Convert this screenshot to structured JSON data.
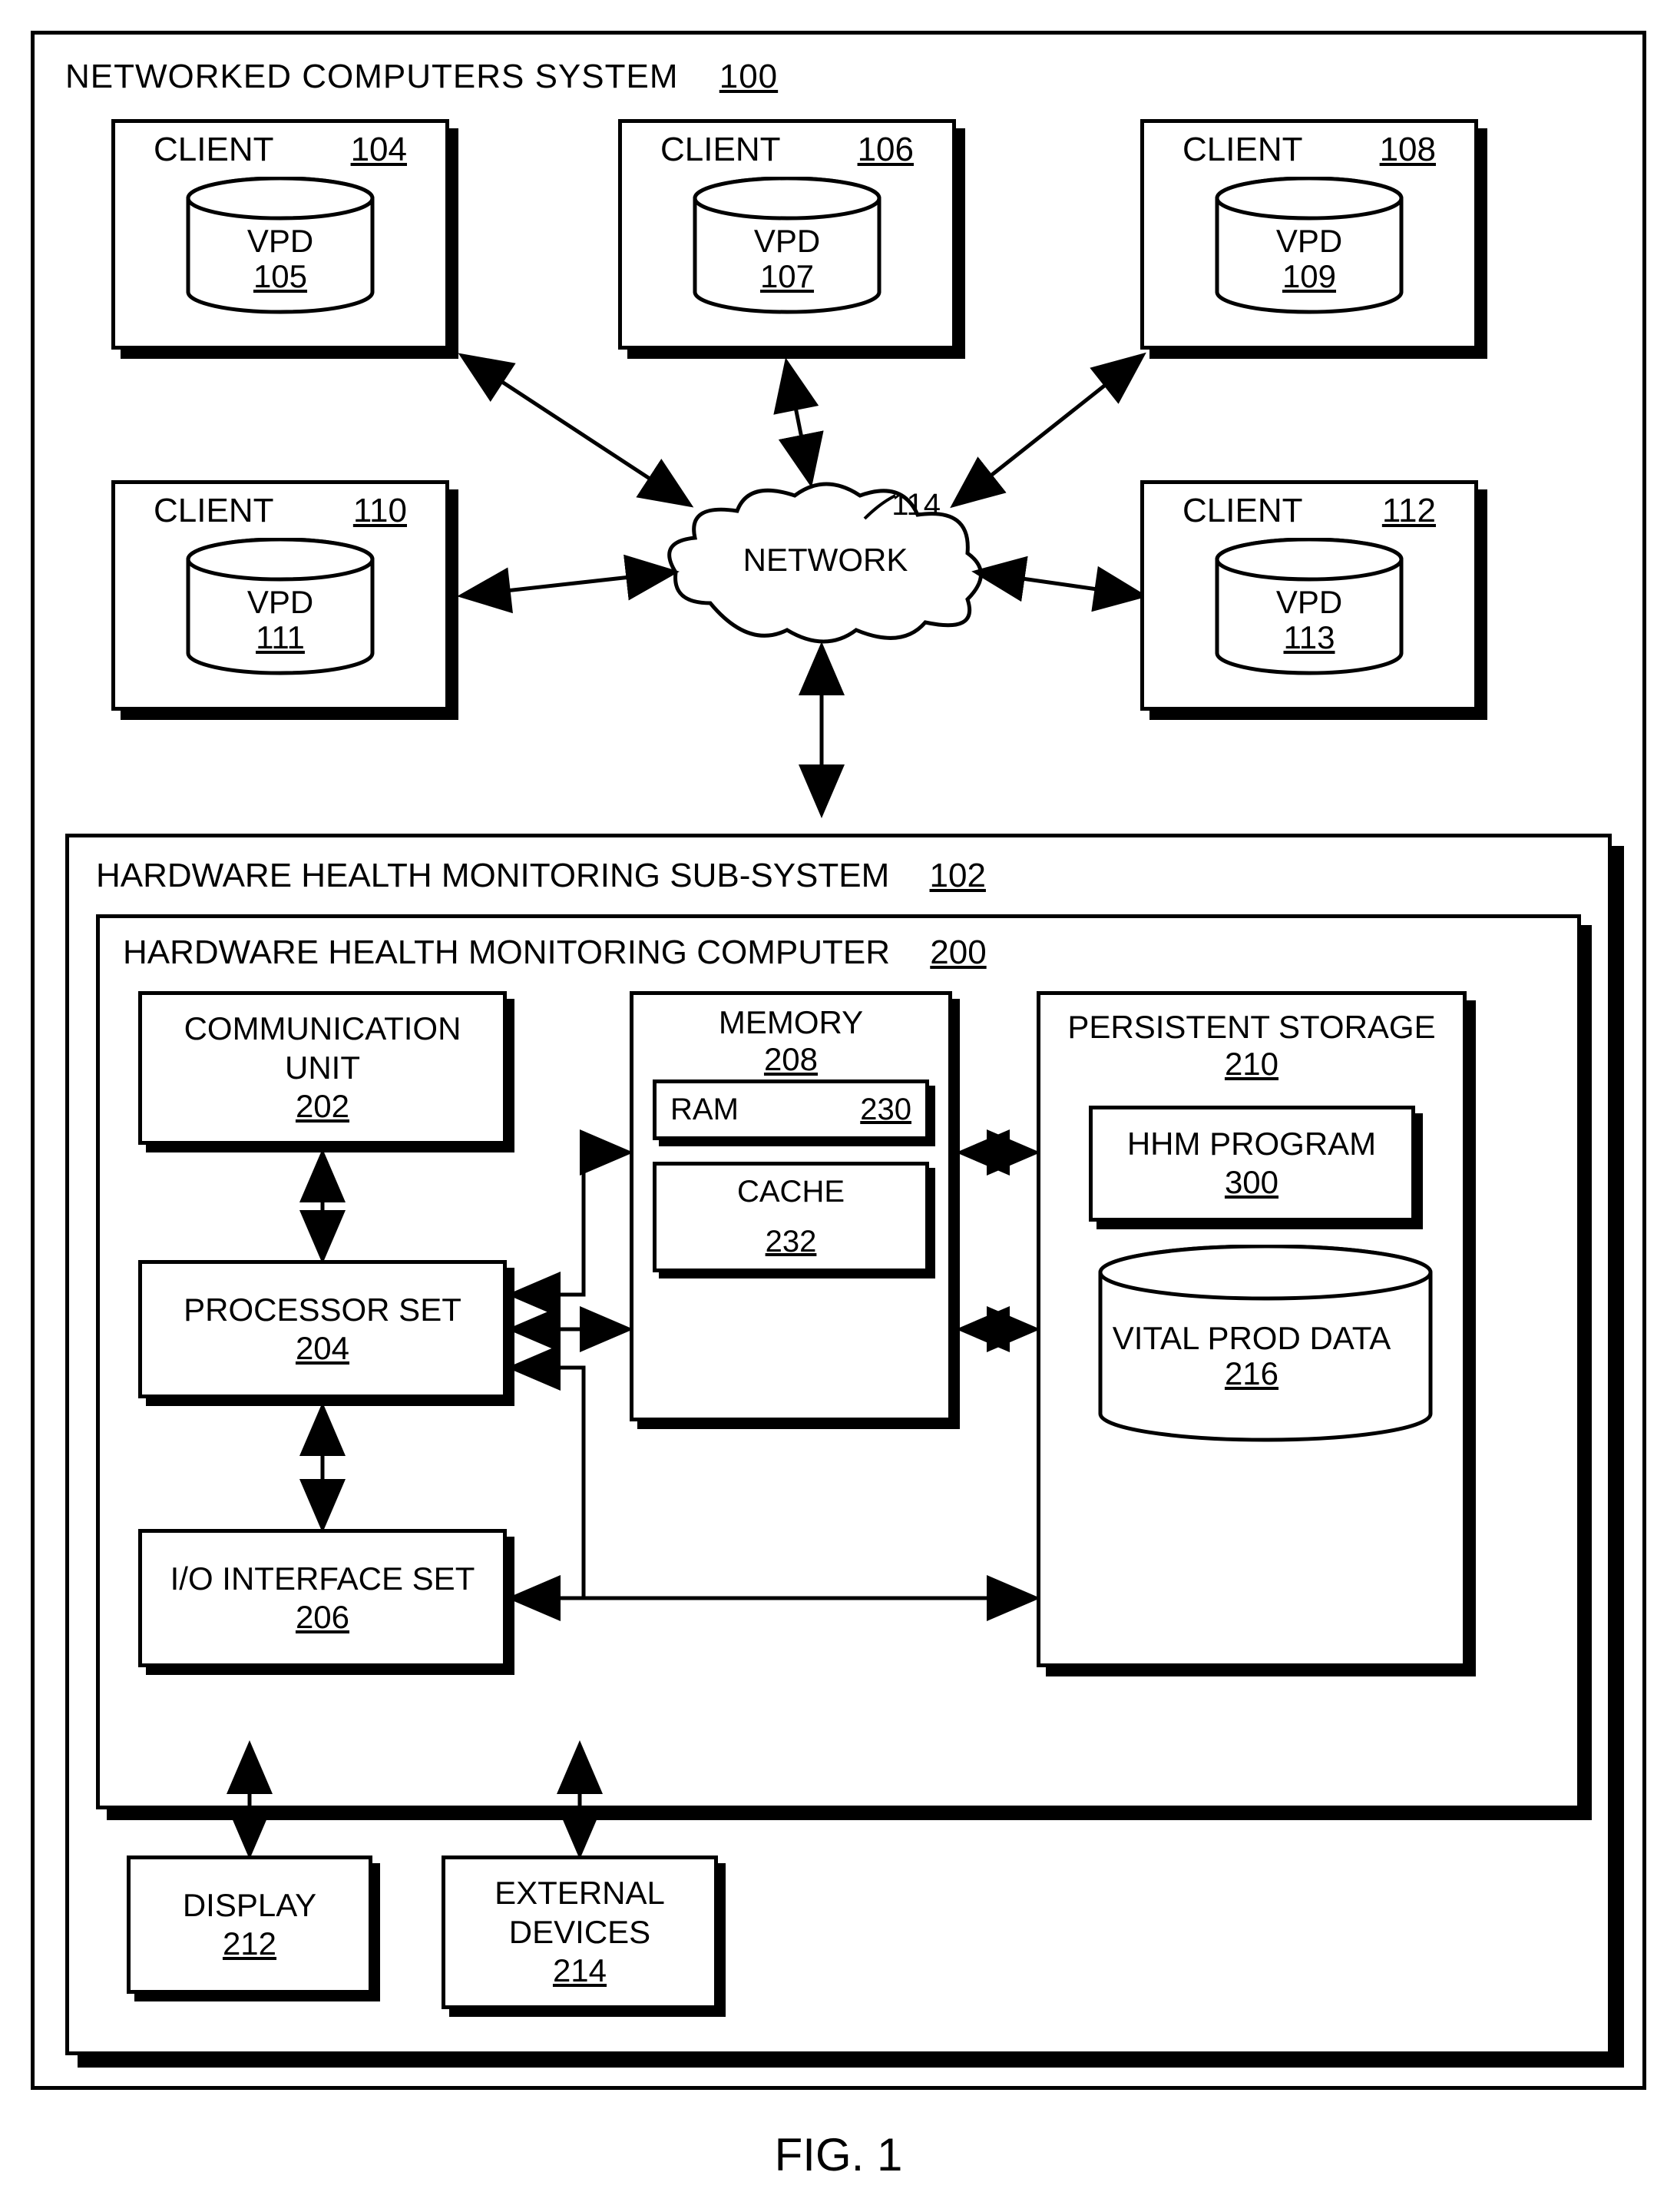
{
  "figure_caption": "FIG. 1",
  "system": {
    "title": "NETWORKED COMPUTERS SYSTEM",
    "ref": "100"
  },
  "clients": [
    {
      "label": "CLIENT",
      "ref": "104",
      "vpd_label": "VPD",
      "vpd_ref": "105"
    },
    {
      "label": "CLIENT",
      "ref": "106",
      "vpd_label": "VPD",
      "vpd_ref": "107"
    },
    {
      "label": "CLIENT",
      "ref": "108",
      "vpd_label": "VPD",
      "vpd_ref": "109"
    },
    {
      "label": "CLIENT",
      "ref": "110",
      "vpd_label": "VPD",
      "vpd_ref": "111"
    },
    {
      "label": "CLIENT",
      "ref": "112",
      "vpd_label": "VPD",
      "vpd_ref": "113"
    }
  ],
  "network": {
    "label": "NETWORK",
    "ref": "114"
  },
  "subsystem": {
    "title": "HARDWARE HEALTH MONITORING SUB-SYSTEM",
    "ref": "102"
  },
  "computer": {
    "title": "HARDWARE HEALTH MONITORING COMPUTER",
    "ref": "200",
    "comm_unit": {
      "label": "COMMUNICATION UNIT",
      "ref": "202"
    },
    "processor": {
      "label": "PROCESSOR SET",
      "ref": "204"
    },
    "io_set": {
      "label": "I/O INTERFACE SET",
      "ref": "206"
    },
    "memory": {
      "label": "MEMORY",
      "ref": "208",
      "ram": {
        "label": "RAM",
        "ref": "230"
      },
      "cache": {
        "label": "CACHE",
        "ref": "232"
      }
    },
    "persistent": {
      "label": "PERSISTENT STORAGE",
      "ref": "210",
      "program": {
        "label": "HHM PROGRAM",
        "ref": "300"
      },
      "vpd": {
        "label": "VITAL PROD DATA",
        "ref": "216"
      }
    }
  },
  "display": {
    "label": "DISPLAY",
    "ref": "212"
  },
  "external": {
    "label": "EXTERNAL DEVICES",
    "ref": "214"
  }
}
